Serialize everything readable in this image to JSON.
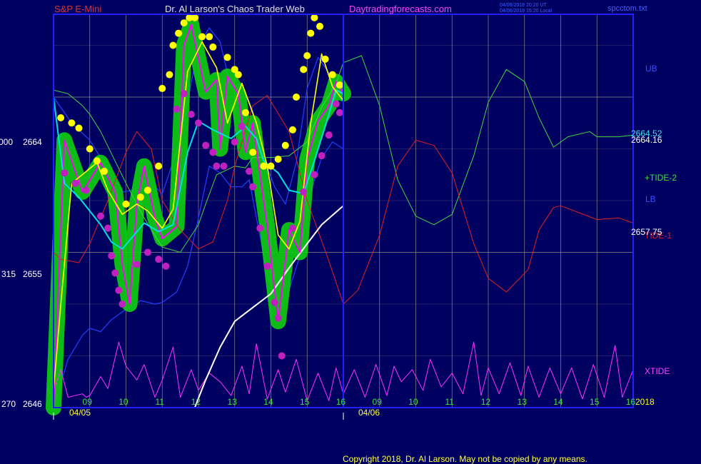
{
  "header": {
    "symbol": "S&P E-Mini",
    "site_title": "Dr. Al Larson's Chaos Trader Web",
    "site_url": "Daytradingforecasts.com",
    "timestamp_ut": "04/06/2018 20:20 UT",
    "timestamp_local": "04/06/2018 15:20 Local",
    "file_name": "spcctom.txt"
  },
  "footer": {
    "copyright": "Copyright 2018, Dr. Al Larson. May not be copied by any means."
  },
  "colors": {
    "background": "#000060",
    "frame": "#2020ff",
    "grid": "#8a8a8a",
    "price": "#ff00ff",
    "ma_fast": "#ffff00",
    "ma_slow": "#00e0e0",
    "tide2": "#40d840",
    "tide1": "#e02020",
    "xtide": "#ff30ff",
    "white_line": "#ffffff",
    "band": "#2040ff",
    "highlight": "#10d010"
  },
  "chart_data": {
    "type": "line",
    "y_axis": {
      "ylim": [
        2646,
        2668.8
      ],
      "ticks": [
        {
          "value": 2664,
          "label": "2664",
          "left_label": "000"
        },
        {
          "value": 2655,
          "label": "2655",
          "left_label": "315"
        },
        {
          "value": 2646,
          "label": "2646",
          "left_label": "270"
        }
      ]
    },
    "x_axis": {
      "hour_labels": [
        "09",
        "10",
        "11",
        "12",
        "13",
        "14",
        "15",
        "16",
        "09",
        "10",
        "11",
        "12",
        "13",
        "14",
        "15",
        "16"
      ],
      "date_labels": [
        "04/05",
        "04/06"
      ],
      "year_label": "2018"
    },
    "right_labels": {
      "price_a": "2664.52",
      "price_b": "2664.16",
      "price_c": "2657.75",
      "ub": "UB",
      "lb": "LB",
      "tide2": "+TIDE-2",
      "tide1": "TIDE-1",
      "xtide": "XTIDE"
    },
    "series": [
      {
        "name": "price",
        "x": [
          0,
          0.3,
          0.8,
          1.3,
          1.7,
          1.9,
          2.1,
          2.3,
          2.5,
          2.8,
          3.0,
          3.4,
          3.6,
          3.8,
          4.2,
          4.5,
          4.6,
          4.8,
          5.1,
          5.3,
          5.5,
          5.9,
          6.2,
          6.5,
          6.8,
          7.0,
          7.3,
          7.6,
          7.8,
          8.0
        ],
        "y": [
          2646,
          2661.5,
          2658.5,
          2660.2,
          2658.5,
          2654.3,
          2652.0,
          2657.8,
          2660.0,
          2657.0,
          2655.8,
          2656.5,
          2667.0,
          2668.2,
          2664.3,
          2665.0,
          2661.0,
          2665.2,
          2664.2,
          2660.8,
          2662.5,
          2656.5,
          2651.0,
          2656.3,
          2655.0,
          2660.4,
          2662.6,
          2663.5,
          2664.9,
          2664.2
        ]
      },
      {
        "name": "ma_fast",
        "x": [
          0,
          0.2,
          0.5,
          1.2,
          1.5,
          1.9,
          2.3,
          2.6,
          3.0,
          3.3,
          3.7,
          4.1,
          4.5,
          4.8,
          5.2,
          5.6,
          5.9,
          6.2,
          6.5,
          6.8,
          7.1,
          7.4,
          7.7,
          8.0
        ],
        "y": [
          2647,
          2652,
          2659,
          2660.2,
          2658.6,
          2657.2,
          2657.8,
          2657.4,
          2656.4,
          2657.5,
          2665.5,
          2667.2,
          2665.7,
          2662.5,
          2664.8,
          2662.5,
          2660.0,
          2656.0,
          2655.2,
          2656.8,
          2662.5,
          2666.5,
          2664.6,
          2663.8
        ]
      },
      {
        "name": "ma_slow",
        "x": [
          0,
          0.3,
          0.7,
          1.3,
          1.6,
          1.9,
          2.1,
          2.5,
          2.9,
          3.3,
          3.7,
          4.0,
          4.4,
          4.9,
          5.3,
          5.6,
          5.8,
          6.2,
          6.5,
          6.9,
          7.2,
          7.5,
          7.8,
          8.0
        ],
        "y": [
          2664,
          2659,
          2658.2,
          2656.6,
          2655.6,
          2655.2,
          2655.7,
          2656.7,
          2656.2,
          2656.6,
          2660.8,
          2662.6,
          2662.1,
          2661.6,
          2662.3,
          2661.6,
          2660.3,
          2659.6,
          2658.6,
          2658.4,
          2660.3,
          2662.3,
          2664.4,
          2664.2
        ]
      },
      {
        "name": "+TIDE-2",
        "x": [
          0,
          0.4,
          0.8,
          1.0,
          1.3,
          2.0,
          2.5,
          3.0,
          3.5,
          4.0,
          4.2,
          4.5,
          5.0,
          5.3,
          5.5,
          6.0,
          6.5,
          7.0,
          7.4,
          7.8,
          8.0,
          8.5,
          9.0,
          9.5,
          10.0,
          10.5,
          11.0,
          11.6,
          12.0,
          12.5,
          13.0,
          13.4,
          13.8,
          14.2,
          14.8,
          15.0,
          15.6,
          16.0
        ],
        "y": [
          2664.4,
          2664.2,
          2663.5,
          2663.0,
          2662,
          2659,
          2657,
          2655.3,
          2655,
          2656.6,
          2657.8,
          2659.5,
          2660.0,
          2659.9,
          2660.5,
          2660.5,
          2660.6,
          2661.4,
          2663.4,
          2664.8,
          2666.0,
          2666.4,
          2663.5,
          2659.2,
          2657.1,
          2656.6,
          2657.2,
          2660.6,
          2663.7,
          2665.6,
          2664.9,
          2662.8,
          2661.1,
          2661.7,
          2662.0,
          2661.7,
          2661.7,
          2661.8
        ]
      },
      {
        "name": "TIDE-1",
        "x": [
          0,
          0.2,
          0.7,
          1.0,
          1.5,
          2.0,
          2.3,
          2.7,
          3.0,
          3.5,
          4.0,
          4.4,
          4.8,
          5.0,
          5.5,
          5.9,
          6.5,
          7.0,
          7.6,
          8.0,
          8.4,
          9.0,
          9.5,
          10.0,
          10.5,
          11.0,
          11.6,
          12.0,
          12.5,
          13.1,
          13.4,
          13.8,
          14.0,
          14.5,
          15.0,
          15.6,
          16.0
        ],
        "y": [
          2655.0,
          2654.6,
          2654.4,
          2655.5,
          2658,
          2660.8,
          2662.0,
          2661.0,
          2658.0,
          2656.3,
          2655.2,
          2655.6,
          2658.0,
          2660.0,
          2663.5,
          2664.1,
          2662,
          2658.0,
          2654.5,
          2652.0,
          2652.8,
          2656.0,
          2660.0,
          2661.5,
          2661.2,
          2659.6,
          2655.5,
          2653.5,
          2652.7,
          2654.0,
          2656.3,
          2657.6,
          2657.7,
          2657.3,
          2656.9,
          2657.0,
          2656.7
        ]
      },
      {
        "name": "XTIDE",
        "x": [
          0,
          0.2,
          0.4,
          0.8,
          0.9,
          1.0,
          1.3,
          1.5,
          1.8,
          2.0,
          2.3,
          2.5,
          2.8,
          3.0,
          3.3,
          3.5,
          3.8,
          4.0,
          4.3,
          4.6,
          4.9,
          5.2,
          5.4,
          5.6,
          5.9,
          6.2,
          6.4,
          6.7,
          7.0,
          7.3,
          7.6,
          7.8,
          8.0,
          8.3,
          8.6,
          8.9,
          9.2,
          9.4,
          9.6,
          9.9,
          10.2,
          10.4,
          10.7,
          11.0,
          11.3,
          11.6,
          11.8,
          12.0,
          12.3,
          12.6,
          12.9,
          13.1,
          13.4,
          13.7,
          14.0,
          14.3,
          14.6,
          14.9,
          15.2,
          15.5,
          15.7,
          16.0
        ],
        "y": [
          2647,
          2648.2,
          2646.6,
          2646.8,
          2646.6,
          2646.7,
          2647.8,
          2647.1,
          2649.8,
          2648.4,
          2647.6,
          2648.5,
          2646.6,
          2647.6,
          2649.5,
          2646.6,
          2648.2,
          2647.0,
          2648.0,
          2647.5,
          2646.7,
          2648.4,
          2646.8,
          2649.7,
          2646.5,
          2648.2,
          2646.9,
          2648.8,
          2646.4,
          2648.0,
          2646.4,
          2648.3,
          2646.8,
          2648.2,
          2646.6,
          2648.5,
          2646.7,
          2648.4,
          2647.5,
          2648.2,
          2647.0,
          2648.8,
          2647.2,
          2648.0,
          2646.8,
          2649.8,
          2646.7,
          2648.3,
          2646.8,
          2648.6,
          2646.7,
          2648.4,
          2646.6,
          2648.3,
          2646.8,
          2648.3,
          2646.5,
          2648.5,
          2646.6,
          2649.6,
          2646.6,
          2648.2
        ]
      },
      {
        "name": "white_line",
        "x": [
          3.9,
          4.2,
          4.6,
          5.0,
          5.5,
          6.0,
          6.5,
          7.0,
          7.4,
          8.0
        ],
        "y": [
          2646,
          2647.6,
          2649.5,
          2651.0,
          2651.8,
          2652.6,
          2654.1,
          2655.5,
          2656.6,
          2657.7
        ]
      },
      {
        "name": "upper_band",
        "x": [
          0,
          0.5,
          1.0,
          1.5,
          1.9,
          2.2,
          2.6,
          3.0,
          3.5,
          4.0,
          4.3,
          4.6,
          4.9,
          5.2,
          5.5,
          5.8,
          6.1,
          6.4,
          6.7,
          7.0,
          7.3,
          7.6,
          8.0
        ],
        "y": [
          2664,
          2662.5,
          2661.5,
          2659.8,
          2658.5,
          2658.6,
          2659.2,
          2658.4,
          2661.5,
          2667.0,
          2668.0,
          2667.2,
          2664.5,
          2664.8,
          2663.2,
          2660.5,
          2658.8,
          2657.8,
          2660.2,
          2664.5,
          2666.3,
          2665.4,
          2664.5
        ]
      },
      {
        "name": "lower_band",
        "x": [
          0,
          0.4,
          0.8,
          1.0,
          1.3,
          1.6,
          2.0,
          2.4,
          2.8,
          3.0,
          3.4,
          3.7,
          4.0,
          4.3,
          4.6,
          4.9,
          5.2,
          5.4,
          5.6,
          5.9,
          6.2,
          6.5,
          6.8,
          7.1,
          7.4,
          7.7,
          8.0
        ],
        "y": [
          2646,
          2648.8,
          2650.2,
          2650.6,
          2650.4,
          2651.1,
          2651.7,
          2652.2,
          2652.0,
          2652.1,
          2652.7,
          2654.2,
          2657.0,
          2660.0,
          2659.6,
          2658.8,
          2658.8,
          2659.2,
          2657.0,
          2653.8,
          2651.6,
          2652.8,
          2654.8,
          2658.5,
          2660.5,
          2661.4,
          2661.0
        ]
      }
    ],
    "markers": {
      "highs": [
        [
          0.2,
          2662.8
        ],
        [
          0.5,
          2662.5
        ],
        [
          0.7,
          2662.2
        ],
        [
          1.0,
          2661.0
        ],
        [
          1.2,
          2660.3
        ],
        [
          1.4,
          2659.7
        ],
        [
          2.0,
          2657.8
        ],
        [
          2.4,
          2658.2
        ],
        [
          2.6,
          2658.6
        ],
        [
          2.9,
          2660.0
        ],
        [
          3.0,
          2664.5
        ],
        [
          3.2,
          2665.3
        ],
        [
          3.3,
          2667.0
        ],
        [
          3.45,
          2667.7
        ],
        [
          3.6,
          2668.3
        ],
        [
          3.75,
          2668.6
        ],
        [
          3.9,
          2668.6
        ],
        [
          4.1,
          2667.5
        ],
        [
          4.3,
          2667.5
        ],
        [
          4.4,
          2666.9
        ],
        [
          4.8,
          2666.3
        ],
        [
          5.0,
          2665.6
        ],
        [
          5.1,
          2665.3
        ],
        [
          5.3,
          2663.1
        ],
        [
          5.5,
          2660.8
        ],
        [
          5.8,
          2660.0
        ],
        [
          6.0,
          2660.0
        ],
        [
          6.2,
          2660.4
        ],
        [
          6.4,
          2661.2
        ],
        [
          6.6,
          2662.1
        ],
        [
          6.7,
          2664.0
        ],
        [
          6.9,
          2665.6
        ],
        [
          7.0,
          2666.4
        ],
        [
          7.1,
          2667.7
        ],
        [
          7.2,
          2668.6
        ],
        [
          7.35,
          2668.1
        ],
        [
          7.5,
          2666.2
        ],
        [
          7.7,
          2665.3
        ],
        [
          7.9,
          2664.7
        ]
      ],
      "lows": [
        [
          0.3,
          2659.6
        ],
        [
          0.6,
          2659.0
        ],
        [
          0.9,
          2658.6
        ],
        [
          1.3,
          2657.1
        ],
        [
          1.5,
          2656.4
        ],
        [
          1.6,
          2654.8
        ],
        [
          1.7,
          2653.8
        ],
        [
          1.8,
          2652.8
        ],
        [
          1.9,
          2652.0
        ],
        [
          2.3,
          2654.3
        ],
        [
          2.6,
          2655.0
        ],
        [
          2.9,
          2654.6
        ],
        [
          3.1,
          2654.2
        ],
        [
          3.4,
          2663.3
        ],
        [
          3.6,
          2664.2
        ],
        [
          3.8,
          2663.0
        ],
        [
          4.0,
          2662.5
        ],
        [
          4.2,
          2661.2
        ],
        [
          4.4,
          2660.8
        ],
        [
          4.5,
          2660.0
        ],
        [
          4.7,
          2660.0
        ],
        [
          5.0,
          2661.4
        ],
        [
          5.2,
          2662.3
        ],
        [
          5.4,
          2659.7
        ],
        [
          5.5,
          2658.8
        ],
        [
          5.7,
          2656.4
        ],
        [
          5.9,
          2654.2
        ],
        [
          6.1,
          2652.1
        ],
        [
          6.2,
          2651.2
        ],
        [
          6.3,
          2649.0
        ],
        [
          6.6,
          2656.4
        ],
        [
          6.9,
          2658.5
        ],
        [
          7.2,
          2659.5
        ],
        [
          7.4,
          2660.6
        ],
        [
          7.6,
          2661.8
        ],
        [
          7.8,
          2663.6
        ],
        [
          7.9,
          2663.1
        ]
      ]
    }
  }
}
